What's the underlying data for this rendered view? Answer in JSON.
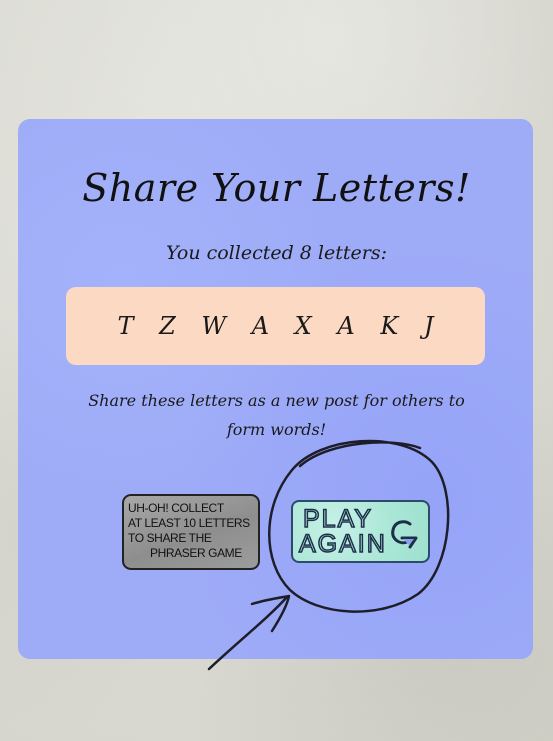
{
  "title": "Share Your Letters!",
  "subtitle": "You collected 8 letters:",
  "letters": {
    "display": "T Z W A X A K J",
    "items": [
      "T",
      "Z",
      "W",
      "A",
      "X",
      "A",
      "K",
      "J"
    ]
  },
  "share_text": "Share these letters as a new post for others to form words!",
  "warning": {
    "lines": [
      "UH-OH! COLLECT",
      "AT LEAST 10 LETTERS",
      "TO SHARE THE",
      "PHRASER GAME"
    ]
  },
  "play_again": {
    "line1": "PLAY",
    "line2": "AGAIN",
    "icon": "replay-icon"
  },
  "colors": {
    "card": "#9eabf7",
    "letters_box": "#fbd9c2",
    "play_button": "#a9e6d6",
    "warning_box": "#9a9a9a",
    "background": "#dcdcd5"
  }
}
